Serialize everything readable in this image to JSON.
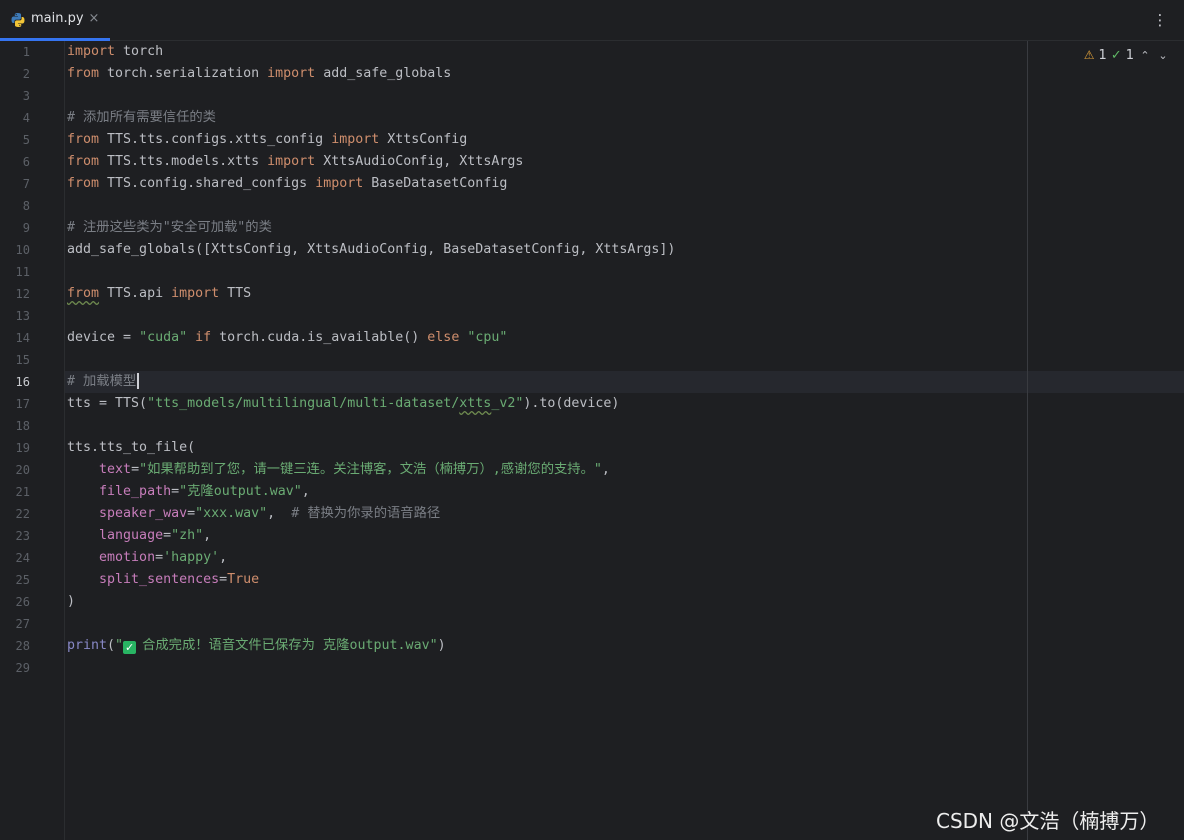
{
  "tab": {
    "filename": "main.py",
    "close_glyph": "×",
    "icon": "python-file-icon"
  },
  "toolbar": {
    "more_glyph": "⋮"
  },
  "inspections": {
    "warnings": "1",
    "ok": "1",
    "warn_glyph": "⚠",
    "ok_glyph": "✓",
    "up_glyph": "⌃",
    "down_glyph": "⌄"
  },
  "current_line": 16,
  "line_numbers": [
    "1",
    "2",
    "3",
    "4",
    "5",
    "6",
    "7",
    "8",
    "9",
    "10",
    "11",
    "12",
    "13",
    "14",
    "15",
    "16",
    "17",
    "18",
    "19",
    "20",
    "21",
    "22",
    "23",
    "24",
    "25",
    "26",
    "27",
    "28",
    "29"
  ],
  "code": {
    "l1": [
      "import",
      " torch"
    ],
    "l2": [
      "from",
      " torch.serialization ",
      "import",
      " add_safe_globals"
    ],
    "l4": "# 添加所有需要信任的类",
    "l5": [
      "from",
      " TTS.tts.configs.xtts_config ",
      "import",
      " XttsConfig"
    ],
    "l6": [
      "from",
      " TTS.tts.models.xtts ",
      "import",
      " XttsAudioConfig, XttsArgs"
    ],
    "l7": [
      "from",
      " TTS.config.shared_configs ",
      "import",
      " BaseDatasetConfig"
    ],
    "l9": "# 注册这些类为\"安全可加载\"的类",
    "l10": "add_safe_globals([XttsConfig, XttsAudioConfig, BaseDatasetConfig, XttsArgs])",
    "l12": [
      "from",
      " TTS.api ",
      "import",
      " TTS"
    ],
    "l14": [
      "device = ",
      "\"cuda\"",
      " if",
      " torch.cuda.is_available() ",
      "else",
      " ",
      "\"cpu\""
    ],
    "l16": "# 加载模型",
    "l17": [
      "tts = TTS(",
      "\"tts_models/multilingual/multi-dataset/",
      "xtts",
      "_v2\"",
      ").to(device)"
    ],
    "l19": "tts.tts_to_file(",
    "l20": [
      "    ",
      "text",
      "=",
      "\"如果帮助到了您，请一键三连。关注博客，文浩（楠搏万）,感谢您的支持。\"",
      ","
    ],
    "l21": [
      "    ",
      "file_path",
      "=",
      "\"克隆output.wav\"",
      ","
    ],
    "l22": [
      "    ",
      "speaker_wav",
      "=",
      "\"xxx.wav\"",
      ",  ",
      "# 替换为你录的语音路径"
    ],
    "l23": [
      "    ",
      "language",
      "=",
      "\"zh\"",
      ","
    ],
    "l24": [
      "    ",
      "emotion",
      "=",
      "'happy'",
      ","
    ],
    "l25": [
      "    ",
      "split_sentences",
      "=",
      "True"
    ],
    "l26": ")",
    "l28": [
      "print",
      "(",
      "\"",
      "合成完成！语音文件已保存为 克隆output.wav\"",
      ")"
    ]
  },
  "watermark": "CSDN @文浩（楠搏万）",
  "colors": {
    "accent": "#3574f0",
    "keyword": "#cf8e6d",
    "string": "#6aab73",
    "comment": "#7a7e85",
    "param": "#c77dbb"
  }
}
